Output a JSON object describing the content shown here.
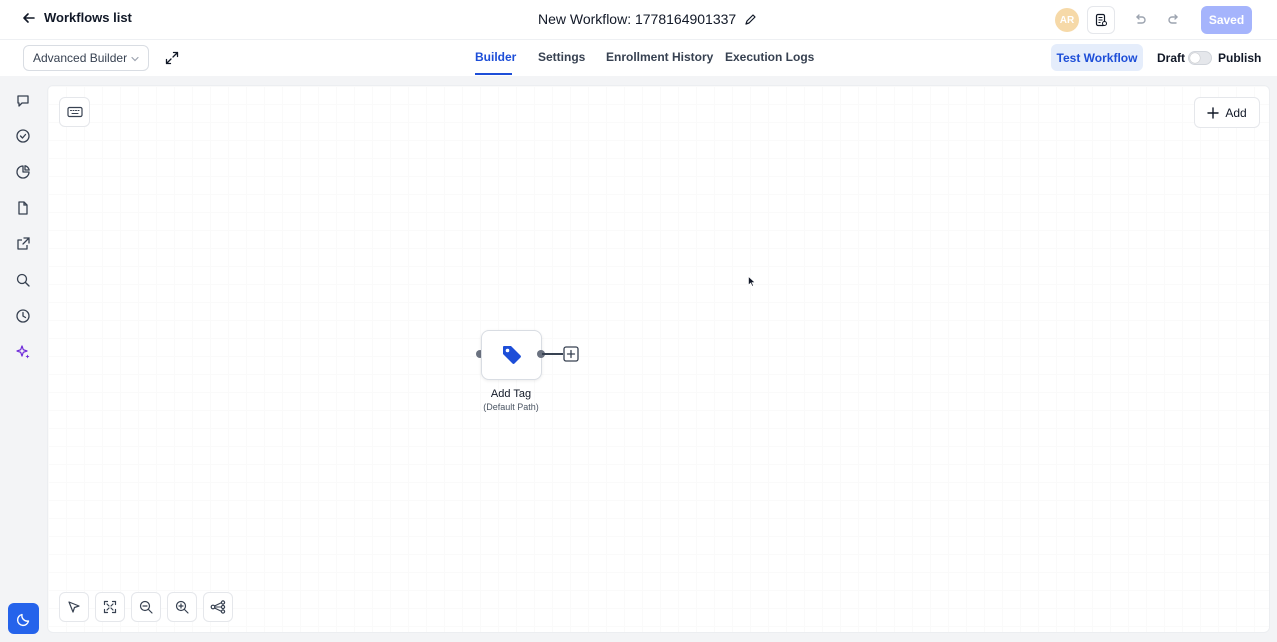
{
  "header": {
    "back_label": "Workflows list",
    "workflow_title": "New Workflow: 1778164901337",
    "avatar_initials": "AR",
    "saved_label": "Saved"
  },
  "subbar": {
    "builder_mode": "Advanced Builder",
    "tabs": [
      {
        "label": "Builder",
        "active": true
      },
      {
        "label": "Settings",
        "active": false
      },
      {
        "label": "Enrollment History",
        "active": false
      },
      {
        "label": "Execution Logs",
        "active": false
      }
    ],
    "test_label": "Test Workflow",
    "draft_label": "Draft",
    "publish_label": "Publish",
    "published": false
  },
  "sidebar": {
    "items": [
      {
        "icon": "chat-icon"
      },
      {
        "icon": "check-circle-icon"
      },
      {
        "icon": "pie-chart-icon"
      },
      {
        "icon": "document-icon"
      },
      {
        "icon": "external-link-icon"
      },
      {
        "icon": "search-icon"
      },
      {
        "icon": "clock-icon"
      },
      {
        "icon": "sparkle-icon"
      }
    ],
    "theme_icon": "moon-icon"
  },
  "canvas": {
    "add_label": "Add",
    "node": {
      "title": "Add Tag",
      "subtitle": "(Default Path)",
      "icon": "tag-icon"
    }
  },
  "colors": {
    "accent": "#1d4ed8",
    "saved_bg": "#a5b4fc",
    "tag_icon": "#1d4ed8",
    "sparkle": "#6d28d9"
  }
}
